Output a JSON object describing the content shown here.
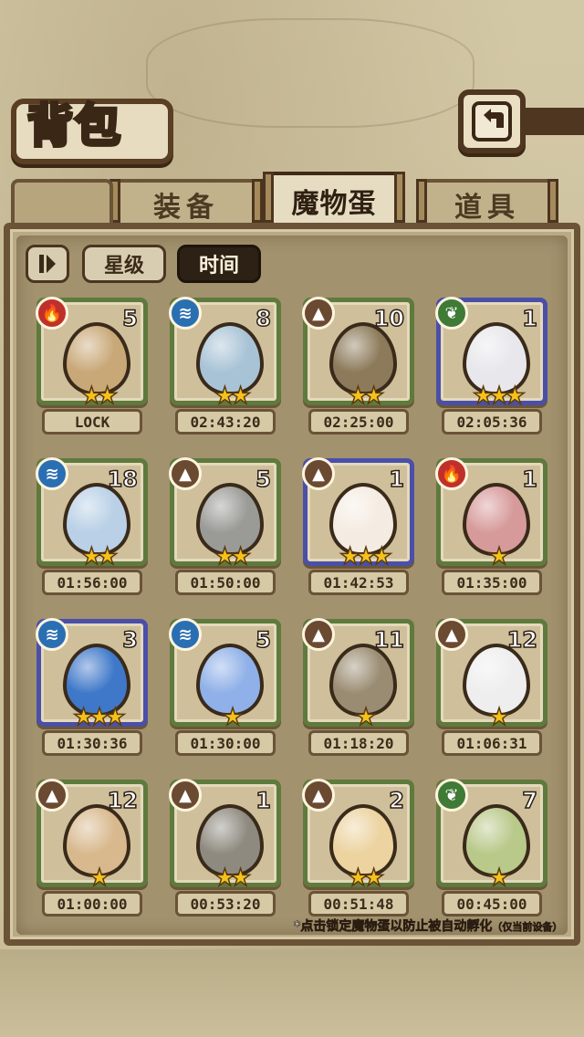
{
  "header": {
    "title": "背包",
    "back_icon": "return-arrow-icon"
  },
  "tabs": [
    {
      "label": "装备",
      "active": false
    },
    {
      "label": "魔物蛋",
      "active": true
    },
    {
      "label": "道具",
      "active": false
    }
  ],
  "sort": {
    "toggle_icon": "sort-toggle-icon",
    "star_label": "星级",
    "time_label": "时间",
    "selected": "时间"
  },
  "colors": {
    "fire": "#c0302a",
    "water": "#2b6fb3",
    "earth": "#6b4a32",
    "leaf": "#3f7a36",
    "frame_common": "#5e7a3c",
    "frame_rare": "#4a4fa8",
    "star": "#f5c21c"
  },
  "eggs": [
    {
      "element": "fire",
      "count": "5",
      "stars": 2,
      "rare": false,
      "time": "LOCK",
      "egg_color": "#c9a878"
    },
    {
      "element": "water",
      "count": "8",
      "stars": 2,
      "rare": false,
      "time": "02:43:20",
      "egg_color": "#a9c3d6"
    },
    {
      "element": "earth",
      "count": "10",
      "stars": 2,
      "rare": false,
      "time": "02:25:00",
      "egg_color": "#8c7a5a"
    },
    {
      "element": "leaf",
      "count": "1",
      "stars": 3,
      "rare": true,
      "time": "02:05:36",
      "egg_color": "#e8e8ec"
    },
    {
      "element": "water",
      "count": "18",
      "stars": 2,
      "rare": false,
      "time": "01:56:00",
      "egg_color": "#b9d0e6"
    },
    {
      "element": "earth",
      "count": "5",
      "stars": 2,
      "rare": false,
      "time": "01:50:00",
      "egg_color": "#9a9a96"
    },
    {
      "element": "earth",
      "count": "1",
      "stars": 3,
      "rare": true,
      "time": "01:42:53",
      "egg_color": "#f4ece2"
    },
    {
      "element": "fire",
      "count": "1",
      "stars": 1,
      "rare": false,
      "time": "01:35:00",
      "egg_color": "#d79a9a"
    },
    {
      "element": "water",
      "count": "3",
      "stars": 3,
      "rare": true,
      "time": "01:30:36",
      "egg_color": "#3f78c9"
    },
    {
      "element": "water",
      "count": "5",
      "stars": 1,
      "rare": false,
      "time": "01:30:00",
      "egg_color": "#8fb0e8"
    },
    {
      "element": "earth",
      "count": "11",
      "stars": 1,
      "rare": false,
      "time": "01:18:20",
      "egg_color": "#9a8c72"
    },
    {
      "element": "earth",
      "count": "12",
      "stars": 1,
      "rare": false,
      "time": "01:06:31",
      "egg_color": "#eeeeee"
    },
    {
      "element": "earth",
      "count": "12",
      "stars": 1,
      "rare": false,
      "time": "01:00:00",
      "egg_color": "#d8b98e"
    },
    {
      "element": "earth",
      "count": "1",
      "stars": 2,
      "rare": false,
      "time": "00:53:20",
      "egg_color": "#8e8a80"
    },
    {
      "element": "earth",
      "count": "2",
      "stars": 2,
      "rare": false,
      "time": "00:51:48",
      "egg_color": "#ecd3a0"
    },
    {
      "element": "leaf",
      "count": "7",
      "stars": 1,
      "rare": false,
      "time": "00:45:00",
      "egg_color": "#b9c98a"
    }
  ],
  "footnote": {
    "main": "*点击锁定魔物蛋以防止被自动孵化",
    "note": "（仅当前设备）"
  }
}
